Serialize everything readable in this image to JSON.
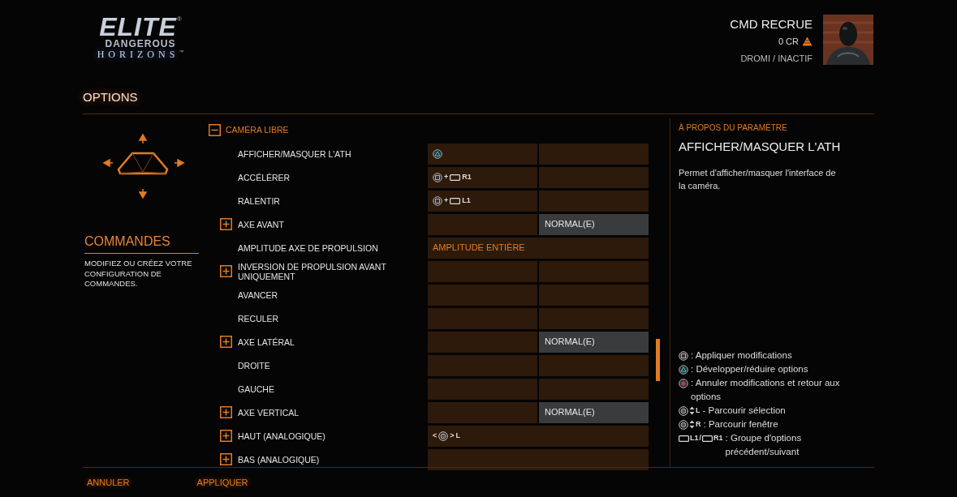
{
  "logo": {
    "title": "ELITE",
    "registered": "®",
    "subtitle": "DANGEROUS",
    "edition": "HORIZONS",
    "trademark": "™"
  },
  "profile": {
    "name": "CMD RECRUE",
    "credits": "0 CR",
    "status": "DROMI / INACTIF"
  },
  "page_title": "OPTIONS",
  "nav": {
    "title": "COMMANDES",
    "description": "MODIFIEZ OU CRÉEZ VOTRE CONFIGURATION DE COMMANDES."
  },
  "group": {
    "label": "CAMÉRA LIBRE",
    "expanded": true
  },
  "rows": [
    {
      "kind": "binding",
      "label": "AFFICHER/MASQUER L'ATH",
      "expandable": false,
      "primary": [
        {
          "kind": "triangle"
        }
      ]
    },
    {
      "kind": "binding",
      "label": "ACCÉLÉRER",
      "expandable": false,
      "primary": [
        {
          "kind": "square"
        },
        {
          "kind": "text",
          "text": "+"
        },
        {
          "kind": "bumper"
        },
        {
          "kind": "text",
          "text": "R1"
        }
      ]
    },
    {
      "kind": "binding",
      "label": "RALENTIR",
      "expandable": false,
      "primary": [
        {
          "kind": "square"
        },
        {
          "kind": "text",
          "text": "+"
        },
        {
          "kind": "bumper"
        },
        {
          "kind": "text",
          "text": "L1"
        }
      ]
    },
    {
      "kind": "axis",
      "label": "AXE AVANT",
      "expandable": true,
      "value": "NORMAL(E)"
    },
    {
      "kind": "option",
      "label": "AMPLITUDE AXE DE PROPULSION",
      "expandable": false,
      "value": "AMPLITUDE ENTIÈRE"
    },
    {
      "kind": "binding",
      "label": "INVERSION DE PROPULSION AVANT UNIQUEMENT",
      "expandable": true
    },
    {
      "kind": "binding",
      "label": "AVANCER",
      "expandable": false
    },
    {
      "kind": "binding",
      "label": "RECULER",
      "expandable": false
    },
    {
      "kind": "axis",
      "label": "AXE LATÉRAL",
      "expandable": true,
      "value": "NORMAL(E)"
    },
    {
      "kind": "binding",
      "label": "DROITE",
      "expandable": false
    },
    {
      "kind": "binding",
      "label": "GAUCHE",
      "expandable": false
    },
    {
      "kind": "axis",
      "label": "AXE VERTICAL",
      "expandable": true,
      "value": "NORMAL(E)"
    },
    {
      "kind": "analog",
      "label": "HAUT (ANALOGIQUE)",
      "expandable": true,
      "primary": [
        {
          "kind": "text",
          "text": "<"
        },
        {
          "kind": "stick"
        },
        {
          "kind": "text",
          "text": ">"
        },
        {
          "kind": "text",
          "text": "L"
        }
      ]
    },
    {
      "kind": "analog",
      "label": "BAS (ANALOGIQUE)",
      "expandable": true
    }
  ],
  "about": {
    "heading": "À PROPOS DU PARAMÈTRE",
    "title": "AFFICHER/MASQUER L'ATH",
    "description": "Permet d'afficher/masquer l'interface de la caméra."
  },
  "legend": [
    {
      "keys": [
        {
          "kind": "square"
        }
      ],
      "text": ": Appliquer modifications"
    },
    {
      "keys": [
        {
          "kind": "triangle"
        }
      ],
      "text": ": Développer/réduire options"
    },
    {
      "keys": [
        {
          "kind": "circle"
        }
      ],
      "text": ": Annuler modifications et retour aux options"
    },
    {
      "keys": [
        {
          "kind": "stick"
        },
        {
          "kind": "updown"
        },
        {
          "kind": "text",
          "text": "L"
        }
      ],
      "text": "- Parcourir sélection"
    },
    {
      "keys": [
        {
          "kind": "stick"
        },
        {
          "kind": "updown"
        },
        {
          "kind": "text",
          "text": "R"
        }
      ],
      "text": ": Parcourir fenêtre"
    },
    {
      "keys": [
        {
          "kind": "bumper"
        },
        {
          "kind": "text",
          "text": "L1"
        },
        {
          "kind": "text",
          "text": "/"
        },
        {
          "kind": "bumper"
        },
        {
          "kind": "text",
          "text": "R1"
        }
      ],
      "text": ": Groupe d'options précédent/suivant"
    }
  ],
  "footer": [
    "ANNULER",
    "APPLIQUER"
  ]
}
